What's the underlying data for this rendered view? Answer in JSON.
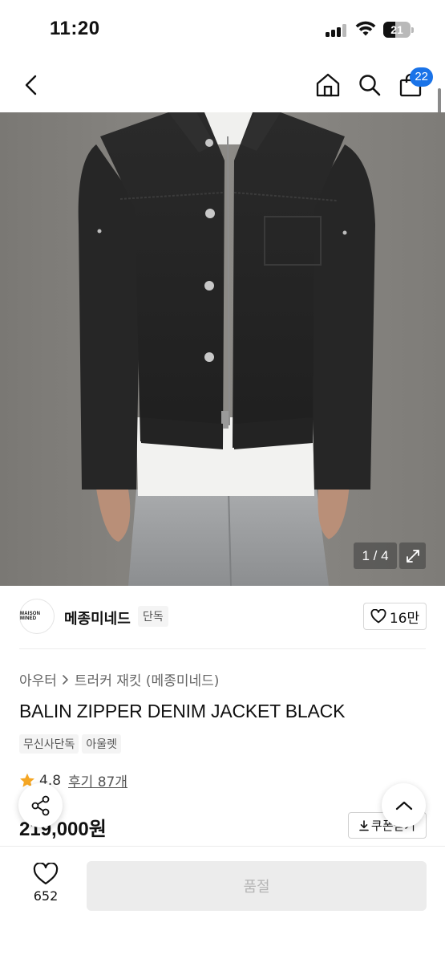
{
  "status_bar": {
    "time": "11:20",
    "battery": "21"
  },
  "nav": {
    "cart_count": "22"
  },
  "gallery": {
    "page_indicator": "1 / 4"
  },
  "brand": {
    "logo_text": "MAISON MINED",
    "name": "메종미네드",
    "tag": "단독",
    "likes": "16만"
  },
  "breadcrumb": {
    "category": "아우터",
    "subcategory": "트러커 재킷 (메종미네드)"
  },
  "product": {
    "title": "BALIN ZIPPER DENIM JACKET BLACK",
    "tags": [
      "무신사단독",
      "아울렛"
    ],
    "rating": "4.8",
    "reviews": "후기 87개",
    "price": "219,000원",
    "coupon_label": "쿠폰받기"
  },
  "bottom_bar": {
    "wish_count": "652",
    "buy_label": "품절"
  },
  "colors": {
    "accent": "#1a73e8",
    "star": "#f5a623",
    "disabled_bg": "#ececec",
    "disabled_text": "#b5b5b5"
  }
}
